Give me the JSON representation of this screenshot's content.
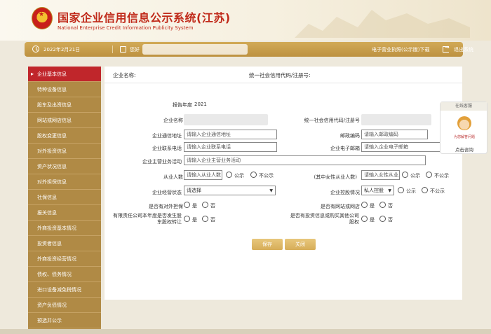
{
  "header": {
    "title": "国家企业信用信息公示系统(江苏)",
    "subtitle": "National Enterprise Credit Information Publicity System"
  },
  "topbar": {
    "date": "2022年2月21日",
    "user_prefix": "您好",
    "license_link": "电子营业执照(公示版)下载",
    "logout_link": "退出系统"
  },
  "sidebar": {
    "items": [
      {
        "label": "企业基本信息",
        "active": true
      },
      {
        "label": "特种设备信息"
      },
      {
        "label": "股东及出资信息"
      },
      {
        "label": "网站或网店信息"
      },
      {
        "label": "股权变更信息"
      },
      {
        "label": "对外投资信息"
      },
      {
        "label": "资产状况信息"
      },
      {
        "label": "对外担保信息"
      },
      {
        "label": "社保信息"
      },
      {
        "label": "报关信息"
      },
      {
        "label": "外商投资基本情况"
      },
      {
        "label": "投资者信息"
      },
      {
        "label": "外商投资经营情况"
      },
      {
        "label": "债权、债务情况"
      },
      {
        "label": "进口设备减免税情况"
      },
      {
        "label": "资产负债情况"
      },
      {
        "label": "预选并公示"
      }
    ]
  },
  "main": {
    "head_company": "企业名称:",
    "head_code": "统一社会信用代码/注册号:",
    "report_year_label": "报告年度",
    "report_year": "2021",
    "company_name_label": "企业名称",
    "credit_code_label": "统一社会信用代码/注册号",
    "address_label": "企业通信地址",
    "address_placeholder": "请输入企业通信地址",
    "postcode_label": "邮政编码",
    "postcode_placeholder": "请输入邮政编码",
    "phone_label": "企业联系电话",
    "phone_placeholder": "请输入企业联系电话",
    "email_label": "企业电子邮箱",
    "email_placeholder": "请输入企业电子邮箱",
    "business_label": "企业主营业务活动",
    "business_placeholder": "请输入企业主营业务活动",
    "employees_label": "从业人数",
    "employees_placeholder": "请输入从业人数",
    "female_label": "(其中女性从业人数)",
    "female_placeholder": "请输入女性从业人数",
    "public": "公示",
    "not_public": "不公示",
    "status_label": "企业经营状态",
    "status_value": "请选择",
    "holding_label": "企业控股情况",
    "holding_value": "私人控股",
    "guarantee_label": "是否有对外担保",
    "website_label": "是否有网站或网店",
    "transfer_label": "有限责任公司本年度是否发生股东股权转让",
    "invest_label": "是否有投资信息或购买其他公司股权",
    "yes": "是",
    "no": "否",
    "save_button": "保存",
    "close_button": "关闭"
  },
  "help": {
    "head": "在线客服",
    "sub": "为您解答问题",
    "link": "点击咨询"
  },
  "colors": {
    "brand_red": "#c02a1a",
    "sidebar": "#b08a45",
    "topbar": "#c79b4a",
    "button": "#dcb463"
  }
}
